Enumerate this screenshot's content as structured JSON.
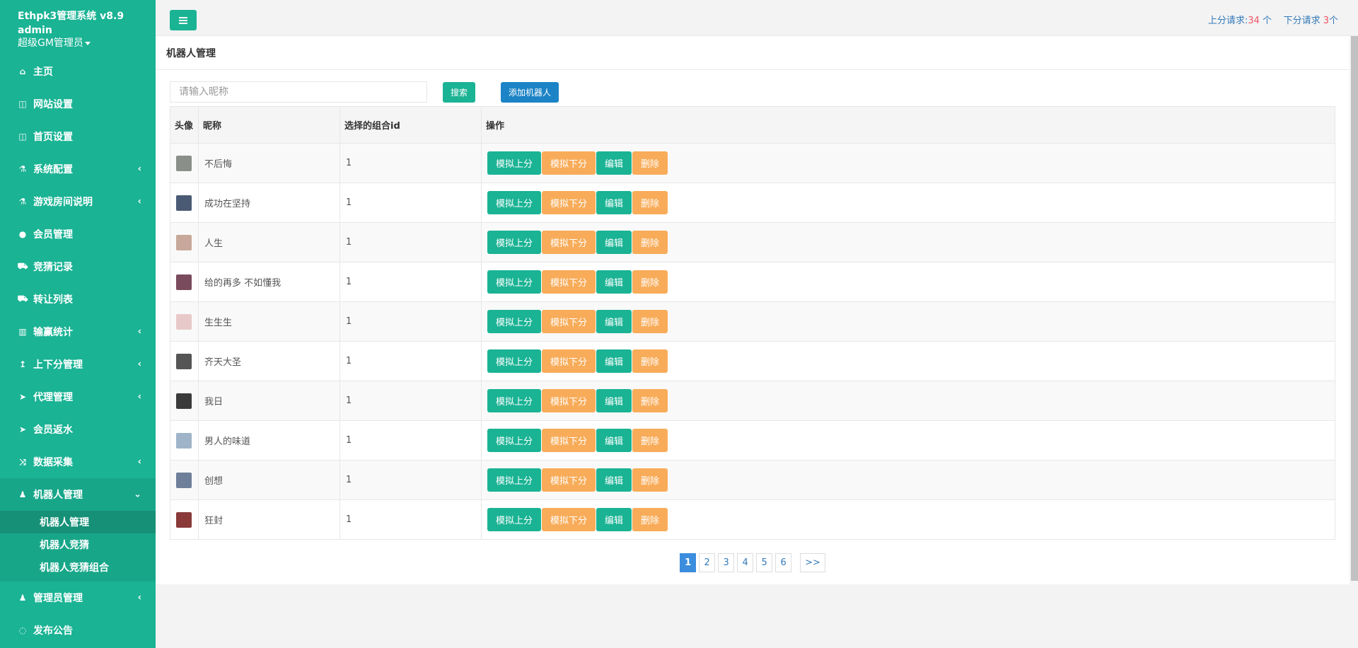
{
  "sidebar": {
    "brand": "Ethpk3管理系统 v8.9",
    "user": "admin",
    "role": "超级GM管理员",
    "items": [
      {
        "label": "主页",
        "icon": "home-icon",
        "glyph": "⌂",
        "arrow": ""
      },
      {
        "label": "网站设置",
        "icon": "columns-icon",
        "glyph": "◫",
        "arrow": ""
      },
      {
        "label": "首页设置",
        "icon": "columns-icon",
        "glyph": "◫",
        "arrow": ""
      },
      {
        "label": "系统配置",
        "icon": "flask-icon",
        "glyph": "⚗",
        "arrow": "‹"
      },
      {
        "label": "游戏房间说明",
        "icon": "flask-icon",
        "glyph": "⚗",
        "arrow": "‹"
      },
      {
        "label": "会员管理",
        "icon": "user-icon",
        "glyph": "●",
        "arrow": ""
      },
      {
        "label": "竞猜记录",
        "icon": "car-icon",
        "glyph": "⛟",
        "arrow": ""
      },
      {
        "label": "转让列表",
        "icon": "car-icon",
        "glyph": "⛟",
        "arrow": ""
      },
      {
        "label": "输赢统计",
        "icon": "bar-chart-icon",
        "glyph": "▥",
        "arrow": "‹"
      },
      {
        "label": "上下分管理",
        "icon": "level-up-icon",
        "glyph": "↥",
        "arrow": "‹"
      },
      {
        "label": "代理管理",
        "icon": "paper-plane-icon",
        "glyph": "➤",
        "arrow": "‹"
      },
      {
        "label": "会员返水",
        "icon": "paper-plane-icon",
        "glyph": "➤",
        "arrow": ""
      },
      {
        "label": "数据采集",
        "icon": "random-icon",
        "glyph": "⤨",
        "arrow": "‹"
      }
    ],
    "robot_group": {
      "label": "机器人管理",
      "icon": "male-icon",
      "glyph": "♟",
      "arrow": "⌄"
    },
    "robot_sub": [
      "机器人管理",
      "机器人竞猜",
      "机器人竞猜组合"
    ],
    "tail_items": [
      {
        "label": "管理员管理",
        "icon": "male-icon",
        "glyph": "♟",
        "arrow": "‹"
      },
      {
        "label": "发布公告",
        "icon": "comment-icon",
        "glyph": "◌",
        "arrow": ""
      }
    ]
  },
  "topbar": {
    "up_label": "上分请求:",
    "up_count": "34",
    "up_unit": " 个",
    "down_label": "下分请求 ",
    "down_count": "3",
    "down_unit": "个"
  },
  "page": {
    "title": "机器人管理",
    "search_placeholder": "请输入昵称",
    "search_btn": "搜索",
    "add_btn": "添加机器人"
  },
  "table": {
    "headers": [
      "头像",
      "昵称",
      "选择的组合id",
      "操作"
    ],
    "actions": [
      "模拟上分",
      "模拟下分",
      "编辑",
      "删除"
    ],
    "rows": [
      {
        "nick": "不后悔",
        "group_id": "1",
        "avatar": "#8a8f8a"
      },
      {
        "nick": "成功在坚持",
        "group_id": "1",
        "avatar": "#4b5a74"
      },
      {
        "nick": "人生",
        "group_id": "1",
        "avatar": "#c7a89a"
      },
      {
        "nick": "给的再多 不如懂我",
        "group_id": "1",
        "avatar": "#7a4b5c"
      },
      {
        "nick": "生生生",
        "group_id": "1",
        "avatar": "#e8c9c9"
      },
      {
        "nick": "齐天大圣",
        "group_id": "1",
        "avatar": "#555555"
      },
      {
        "nick": "我日",
        "group_id": "1",
        "avatar": "#3a3a3a"
      },
      {
        "nick": "男人的味道",
        "group_id": "1",
        "avatar": "#9fb4c8"
      },
      {
        "nick": "创想",
        "group_id": "1",
        "avatar": "#6e7f9a"
      },
      {
        "nick": "狂封",
        "group_id": "1",
        "avatar": "#8b3a3a"
      }
    ]
  },
  "pagination": {
    "pages": [
      "1",
      "2",
      "3",
      "4",
      "5",
      "6"
    ],
    "current": "1",
    "next": ">>"
  }
}
